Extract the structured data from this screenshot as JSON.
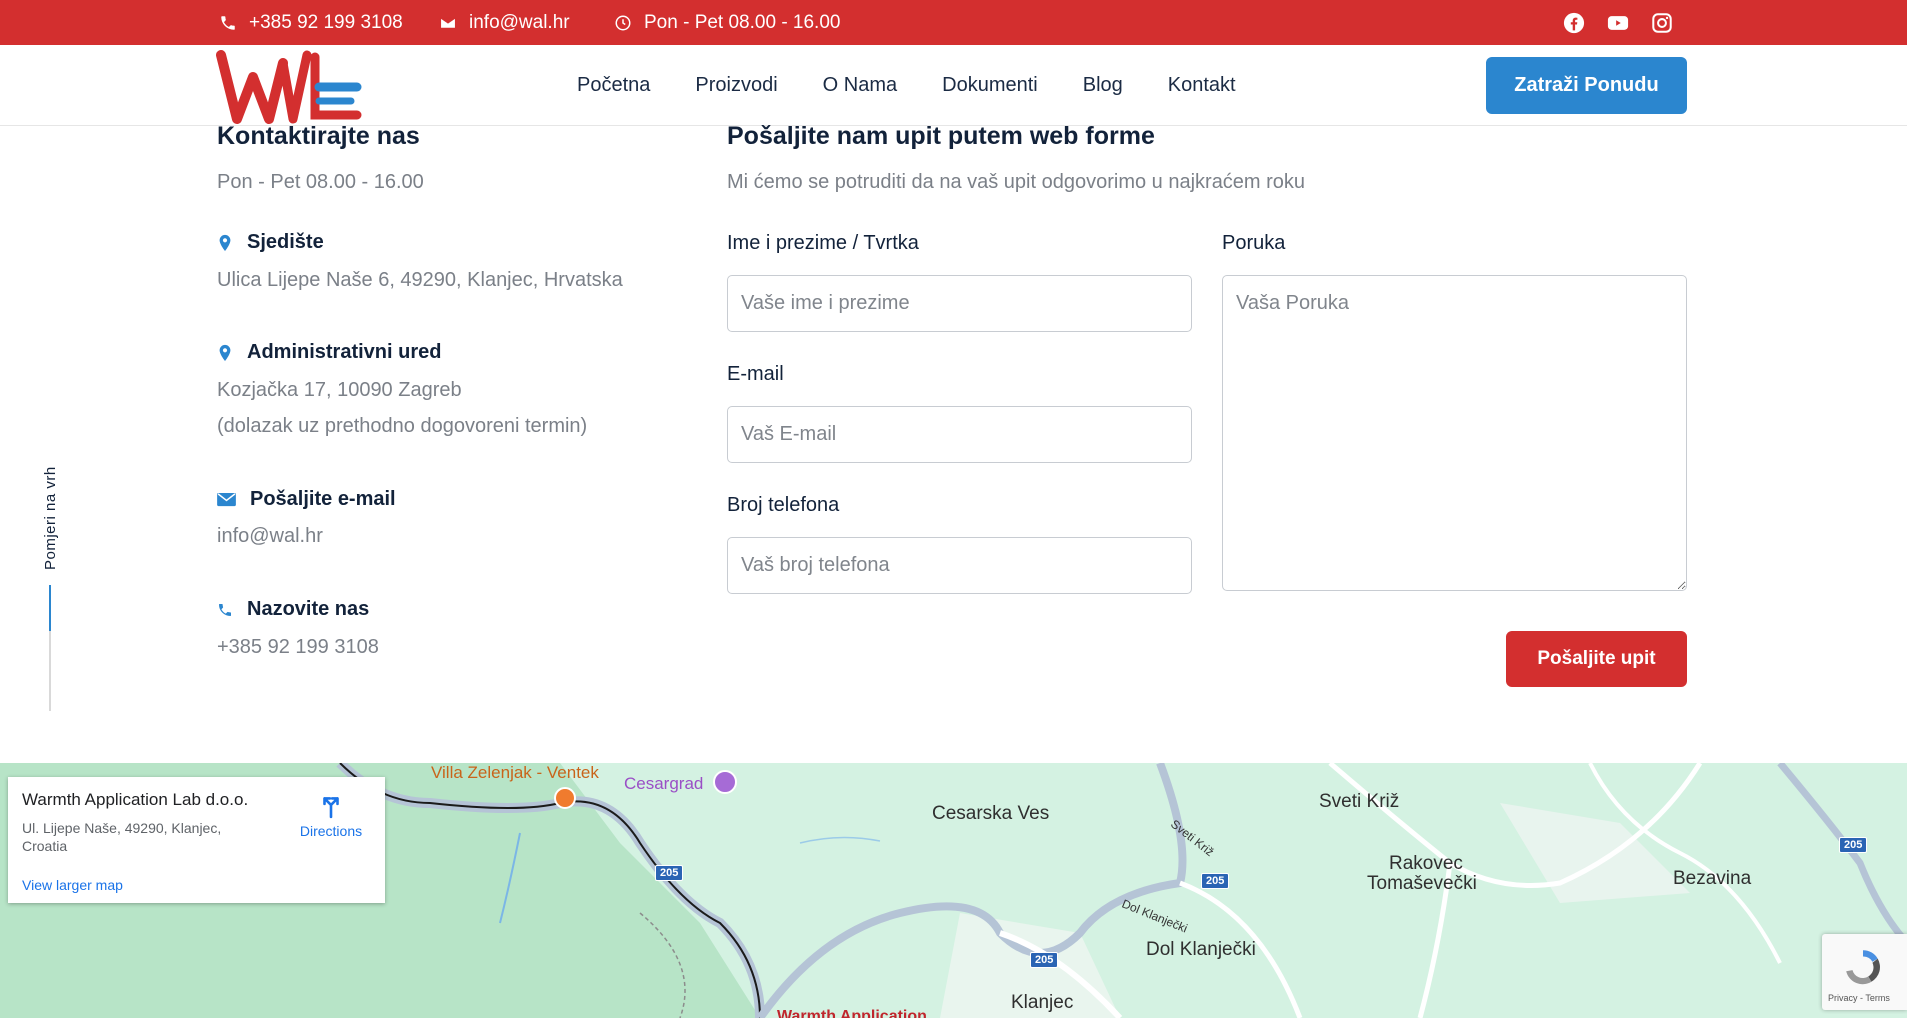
{
  "topbar": {
    "phone": "+385 92 199 3108",
    "email": "info@wal.hr",
    "hours": "Pon - Pet 08.00 - 16.00",
    "social": [
      "facebook-icon",
      "youtube-icon",
      "instagram-icon"
    ]
  },
  "nav": {
    "items": [
      "Početna",
      "Proizvodi",
      "O Nama",
      "Dokumenti",
      "Blog",
      "Kontakt"
    ],
    "cta": "Zatraži Ponudu"
  },
  "contact": {
    "title": "Kontaktirajte nas",
    "hours": "Pon - Pet 08.00 - 16.00",
    "hq_title": "Sjedište",
    "hq_address": "Ulica Lijepe Naše 6, 49290, Klanjec, Hrvatska",
    "office_title": "Administrativni ured",
    "office_address": "Kozjačka 17, 10090 Zagreb",
    "office_note": "(dolazak uz prethodno dogovoreni termin)",
    "email_title": "Pošaljite e-mail",
    "email_value": "info@wal.hr",
    "phone_title": "Nazovite nas",
    "phone_value": "+385 92 199 3108"
  },
  "back_to_top": "Pomjeri na vrh",
  "form": {
    "title": "Pošaljite nam upit putem web forme",
    "subtitle": "Mi ćemo se potruditi da na vaš upit odgovorimo u najkraćem roku",
    "name_label": "Ime i prezime / Tvrtka",
    "name_placeholder": "Vaše ime i prezime",
    "email_label": "E-mail",
    "email_placeholder": "Vaš E-mail",
    "phone_label": "Broj telefona",
    "phone_placeholder": "Vaš broj telefona",
    "message_label": "Poruka",
    "message_placeholder": "Vaša Poruka",
    "submit": "Pošaljite upit"
  },
  "map": {
    "card_title": "Warmth Application Lab d.o.o.",
    "card_address": "Ul. Lijepe Naše, 49290, Klanjec, Croatia",
    "card_link": "View larger map",
    "card_directions": "Directions",
    "labels": {
      "villa": "Villa Zelenjak - Ventek",
      "cesargrad": "Cesargrad",
      "cesarska_ves": "Cesarska Ves",
      "sveti_kriz": "Sveti Križ",
      "rakovec": "Rakovec",
      "tomasevecki": "Tomaševečki",
      "bezavina": "Bezavina",
      "dol_klanjecki": "Dol Klanječki",
      "klanjec": "Klanjec",
      "road_sveti_kriz": "Sveti Križ",
      "road_dol": "Dol Klanječki",
      "warmth_partial": "Warmth Application"
    },
    "road_number": "205",
    "recaptcha": "Privacy - Terms"
  },
  "colors": {
    "brand_red": "#d32f2f",
    "brand_blue": "#2b86cf"
  }
}
